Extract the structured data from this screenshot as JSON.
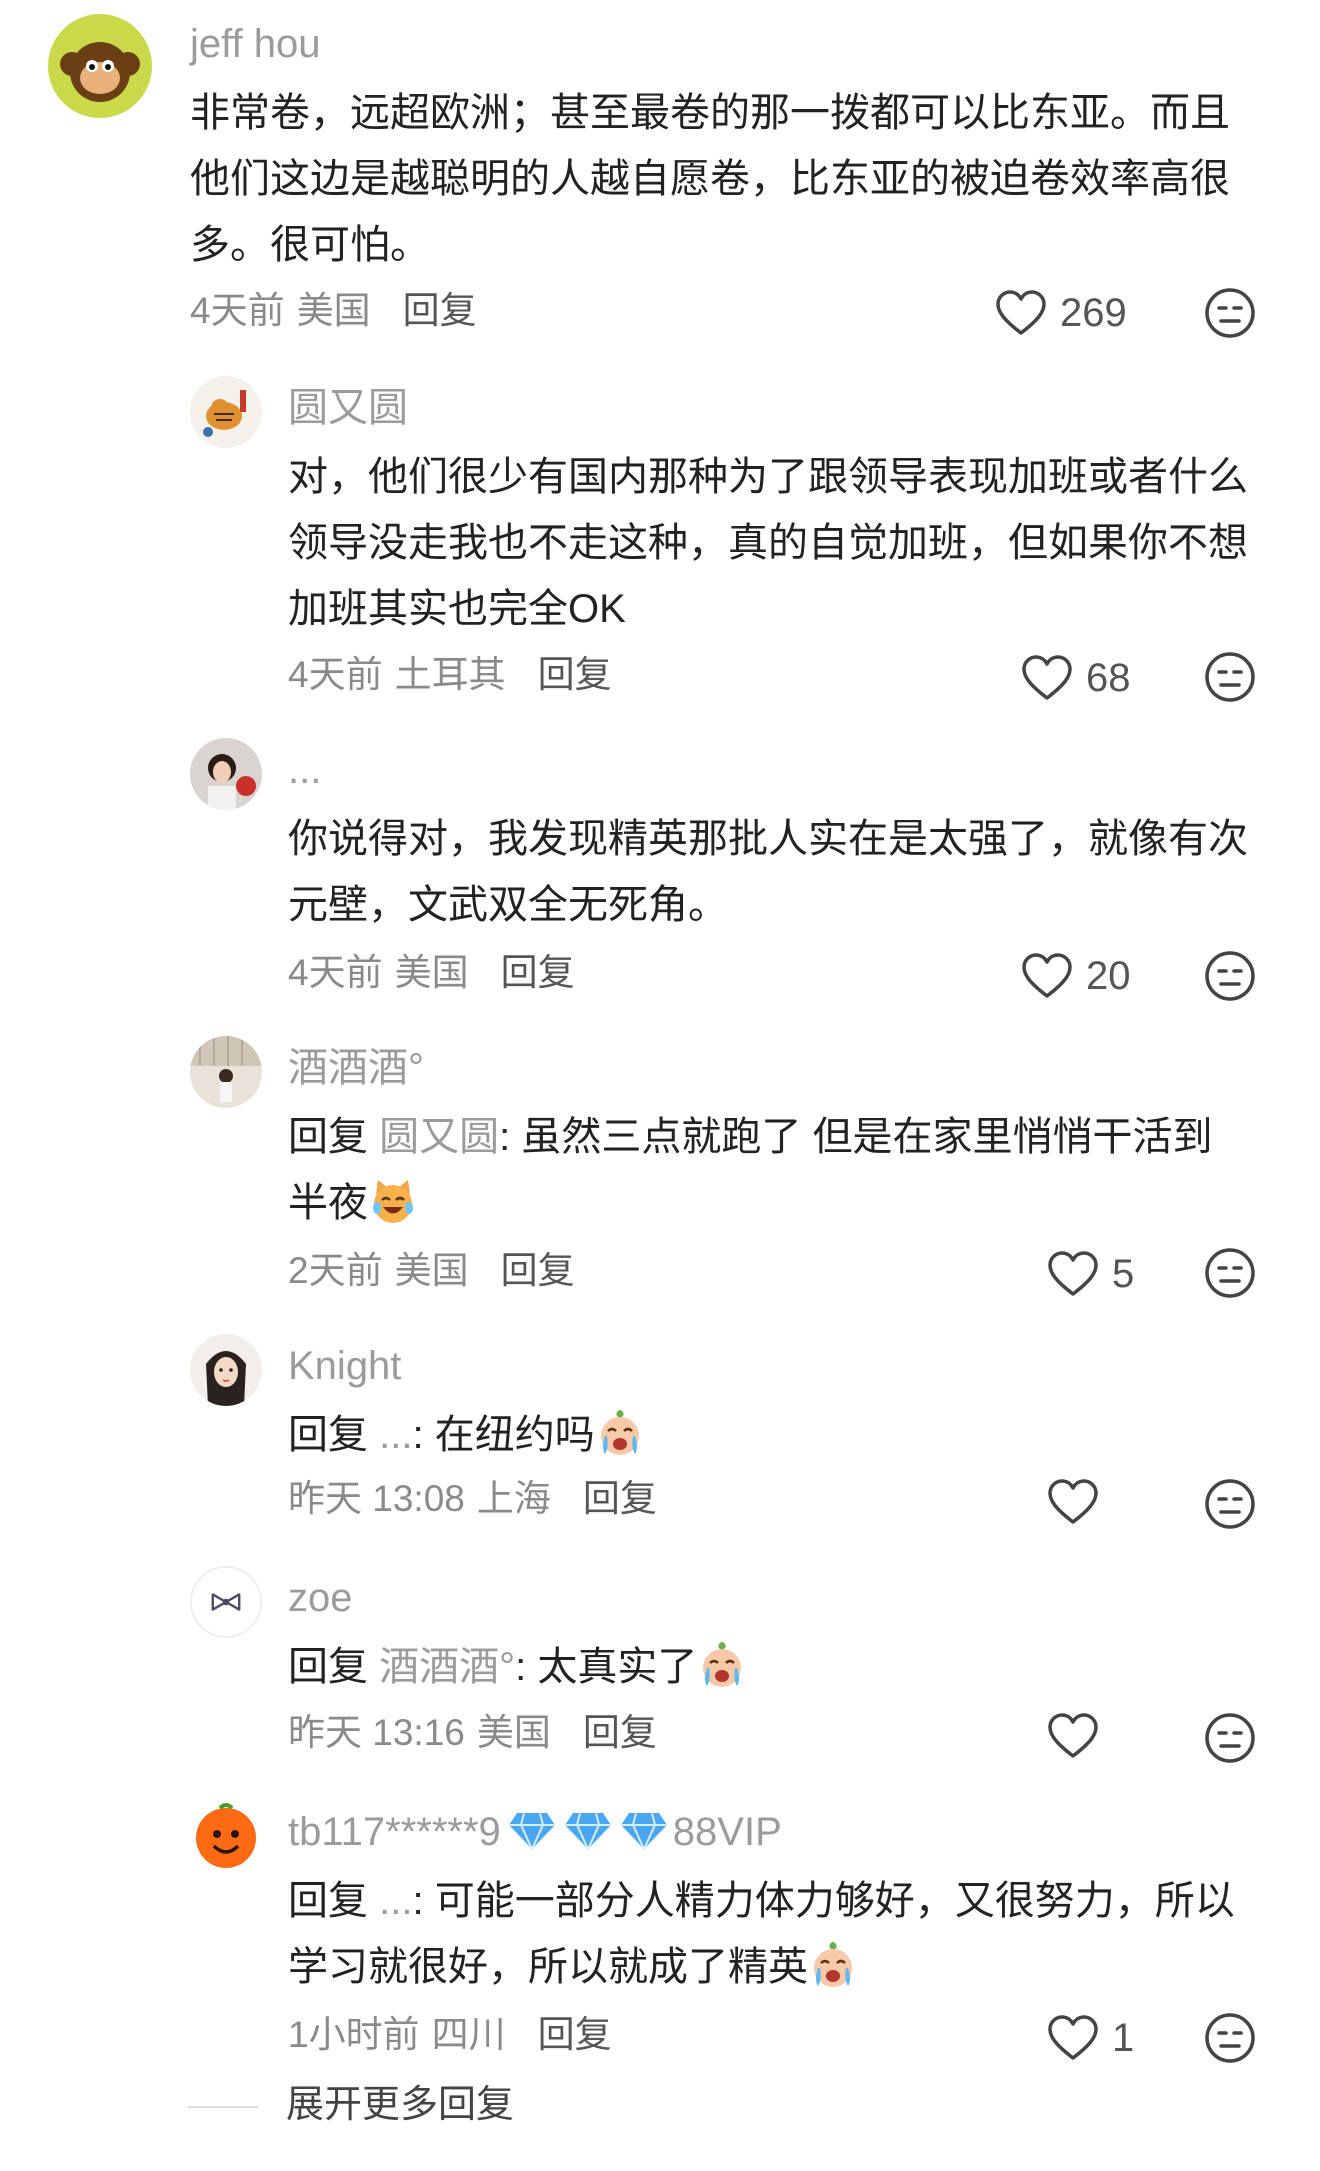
{
  "comments": [
    {
      "username": "jeff hou",
      "text": "非常卷，远超欧洲；甚至最卷的那一拨都可以比东亚。而且他们这边是越聪明的人越自愿卷，比东亚的被迫卷效率高很多。很可怕。",
      "time": "4天前",
      "location": "美国",
      "reply_label": "回复",
      "likes": "269",
      "avatar_icon": "monkey-avatar-icon"
    },
    {
      "username": "圆又圆",
      "text": "对，他们很少有国内那种为了跟领导表现加班或者什么领导没走我也不走这种，真的自觉加班，但如果你不想加班其实也完全OK",
      "time": "4天前",
      "location": "土耳其",
      "reply_label": "回复",
      "likes": "68",
      "avatar_icon": "tiger-painting-avatar-icon"
    },
    {
      "username": "...",
      "text": "你说得对，我发现精英那批人实在是太强了，就像有次元壁，文武双全无死角。",
      "time": "4天前",
      "location": "美国",
      "reply_label": "回复",
      "likes": "20",
      "avatar_icon": "woman-photo-avatar-icon"
    },
    {
      "username": "酒酒酒°",
      "reply_prefix": "回复",
      "reply_target": "圆又圆",
      "text": ": 虽然三点就跑了 但是在家里悄悄干活到半夜",
      "emoji": "laughing-cat-emoji",
      "time": "2天前",
      "location": "美国",
      "reply_label": "回复",
      "likes": "5",
      "avatar_icon": "room-photo-avatar-icon"
    },
    {
      "username": "Knight",
      "reply_prefix": "回复",
      "reply_target": "...",
      "text": ": 在纽约吗",
      "emoji": "crying-face-emoji",
      "time": "昨天 13:08",
      "location": "上海",
      "reply_label": "回复",
      "likes": "",
      "avatar_icon": "girl-drawing-avatar-icon"
    },
    {
      "username": "zoe",
      "reply_prefix": "回复",
      "reply_target": "酒酒酒°",
      "text": ": 太真实了",
      "emoji": "crying-face-emoji",
      "time": "昨天 13:16",
      "location": "美国",
      "reply_label": "回复",
      "likes": "",
      "avatar_icon": "bow-avatar-icon"
    },
    {
      "username": "tb117******9",
      "badge": "88VIP",
      "badge_icons": [
        "diamond-icon",
        "diamond-icon",
        "diamond-icon"
      ],
      "reply_prefix": "回复",
      "reply_target": "...",
      "text": ": 可能一部分人精力体力够好，又很努力，所以学习就很好，所以就成了精英",
      "emoji": "crying-face-emoji",
      "time": "1小时前",
      "location": "四川",
      "reply_label": "回复",
      "likes": "1",
      "avatar_icon": "orange-mascot-avatar-icon"
    }
  ],
  "expand_more": "展开更多回复",
  "colors": {
    "username": "#9b9b9b",
    "text": "#222222",
    "meta": "#8a8a8a",
    "diamond": "#4aa8f0"
  }
}
